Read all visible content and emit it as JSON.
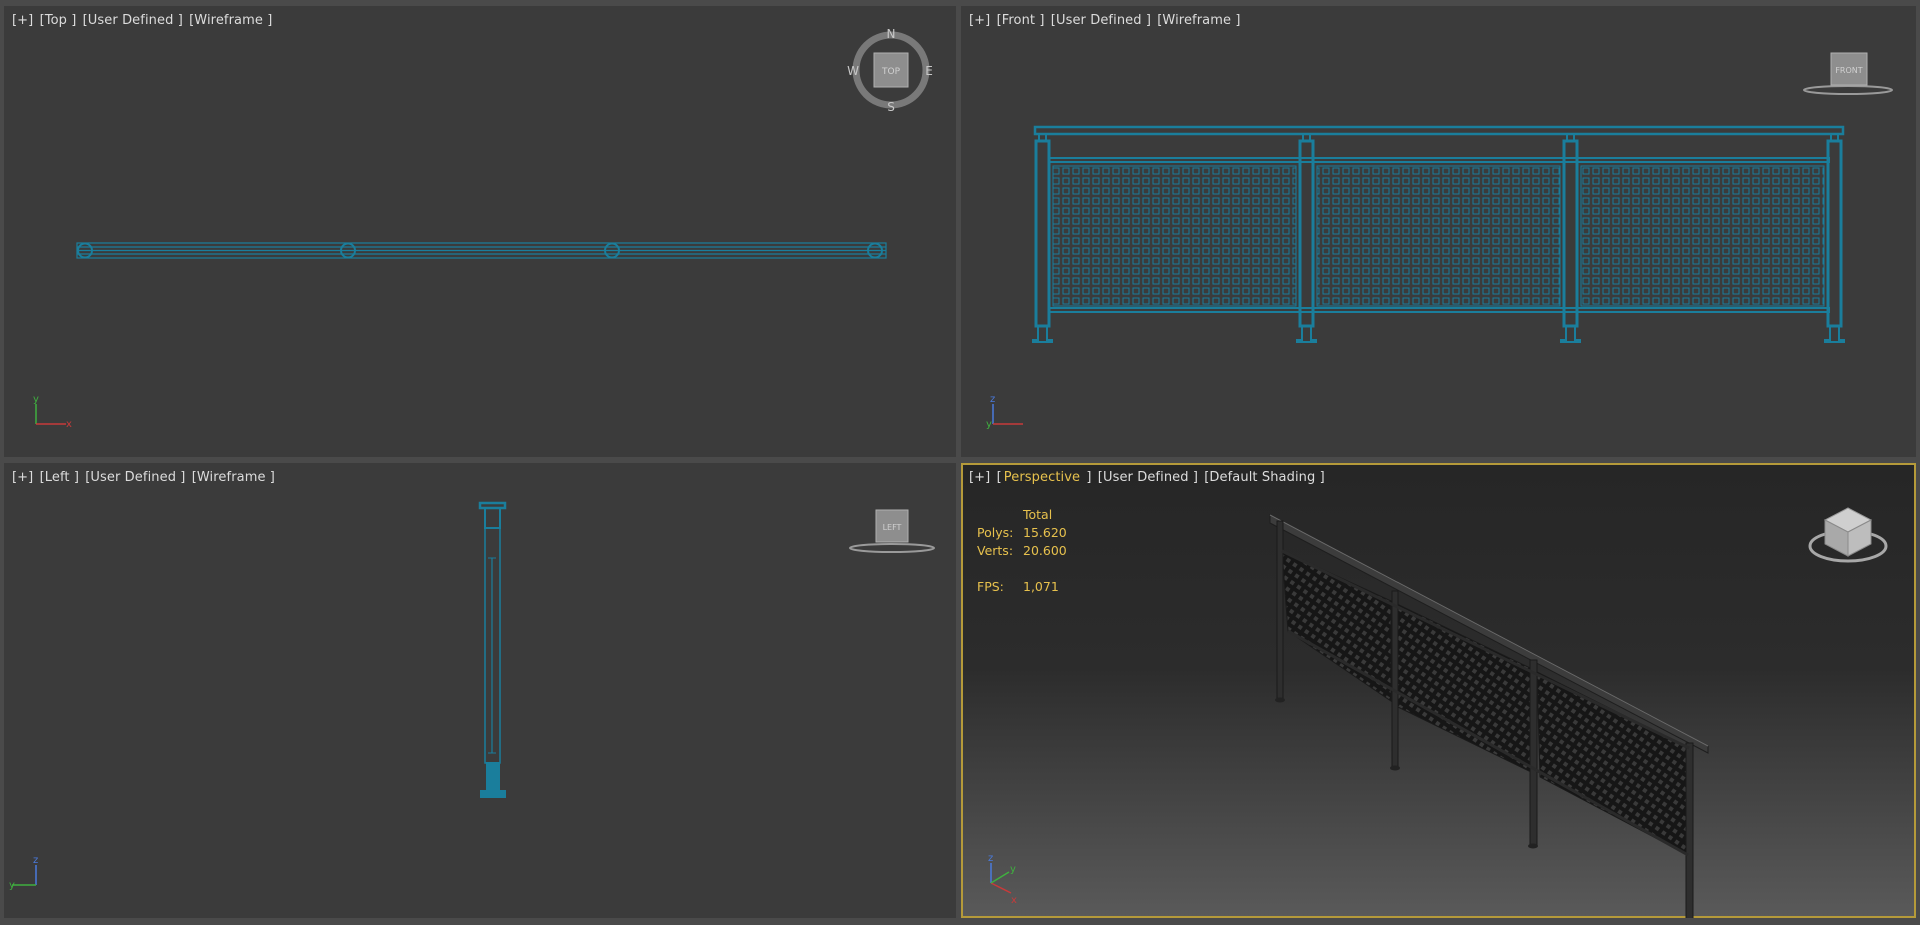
{
  "viewports": {
    "top": {
      "plus": "[+]",
      "view": "[Top ]",
      "mode": "[User Defined ]",
      "shading": "[Wireframe ]"
    },
    "front": {
      "plus": "[+]",
      "view": "[Front ]",
      "mode": "[User Defined ]",
      "shading": "[Wireframe ]"
    },
    "left": {
      "plus": "[+]",
      "view": "[Left ]",
      "mode": "[User Defined ]",
      "shading": "[Wireframe ]"
    },
    "perspective": {
      "plus": "[+]",
      "view": "Perspective",
      "mode": "[User Defined ]",
      "shading": "[Default Shading ]"
    }
  },
  "stats": {
    "header": "Total",
    "polys_label": "Polys:",
    "polys_value": "15.620",
    "verts_label": "Verts:",
    "verts_value": "20.600",
    "fps_label": "FPS:",
    "fps_value": "1,071"
  },
  "compass": {
    "n": "N",
    "s": "S",
    "e": "E",
    "w": "W",
    "top_cube": "TOP"
  },
  "viewcube": {
    "front": "FRONT",
    "left": "LEFT"
  },
  "axes": {
    "x": "x",
    "y": "y",
    "z": "z"
  },
  "colors": {
    "wire": "#1a7e9c",
    "active_border": "#b59a3a",
    "stats": "#e7c14d"
  }
}
